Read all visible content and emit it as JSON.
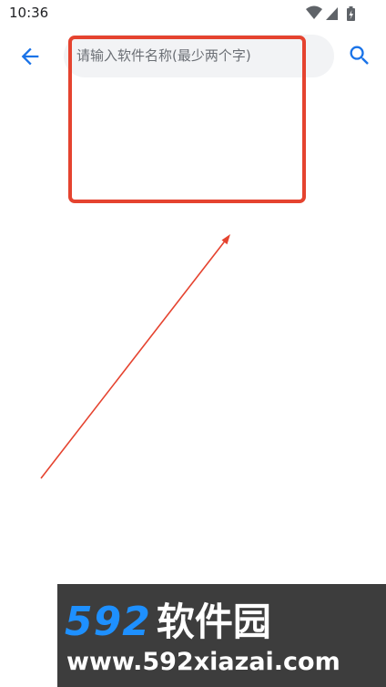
{
  "status_bar": {
    "time": "10:36",
    "icons": [
      "wifi-icon",
      "signal-icon",
      "battery-charging-icon"
    ]
  },
  "header": {
    "back_icon": "arrow-left-icon",
    "search_placeholder": "请输入软件名称(最少两个字)",
    "search_value": "",
    "search_icon": "magnifier-icon"
  },
  "annotation": {
    "color": "#e5432f"
  },
  "watermark": {
    "brand_number": "592",
    "brand_text": "软件园",
    "url": "www.592xiazai.com"
  },
  "colors": {
    "accent": "#1a73e8",
    "search_box_bg": "#f2f3f5",
    "watermark_bg": "#3d3d3d",
    "watermark_number": "#1e90ff"
  }
}
